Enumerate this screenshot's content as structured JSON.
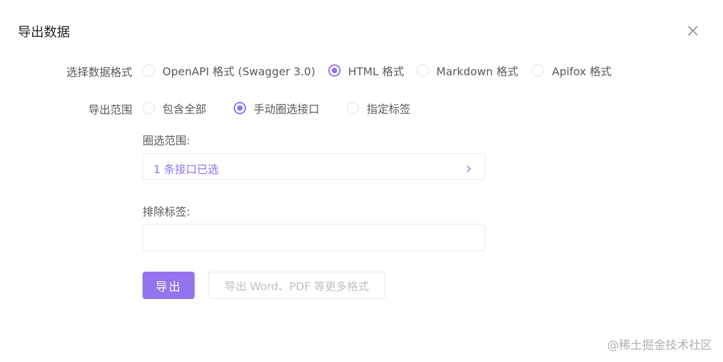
{
  "dialog": {
    "title": "导出数据"
  },
  "format": {
    "label": "选择数据格式",
    "options": [
      {
        "label": "OpenAPI 格式 (Swagger 3.0)",
        "checked": false
      },
      {
        "label": "HTML 格式",
        "checked": true
      },
      {
        "label": "Markdown 格式",
        "checked": false
      },
      {
        "label": "Apifox 格式",
        "checked": false
      }
    ]
  },
  "scope": {
    "label": "导出范围",
    "options": [
      {
        "label": "包含全部",
        "checked": false
      },
      {
        "label": "手动圈选接口",
        "checked": true
      },
      {
        "label": "指定标签",
        "checked": false
      }
    ]
  },
  "selection": {
    "label": "圈选范围:",
    "value": "1 条接口已选"
  },
  "exclude_tags": {
    "label": "排除标签:",
    "value": ""
  },
  "actions": {
    "export_label": "导出",
    "more_formats_label": "导出 Word、PDF 等更多格式"
  },
  "watermark": "@稀土掘金技术社区",
  "colors": {
    "accent": "#9373ee",
    "border": "#e8e8e8"
  }
}
